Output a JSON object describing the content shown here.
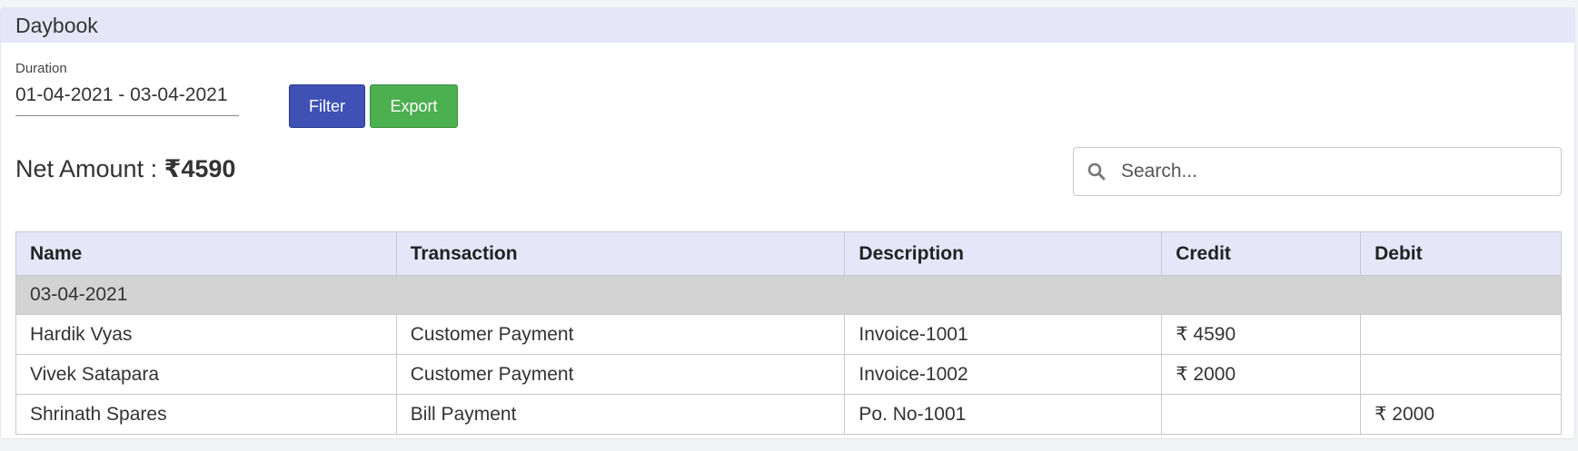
{
  "header": {
    "title": "Daybook"
  },
  "filter": {
    "duration_label": "Duration",
    "duration_value": "01-04-2021 - 03-04-2021",
    "filter_button": "Filter",
    "export_button": "Export"
  },
  "summary": {
    "net_amount_label": "Net Amount : ",
    "net_amount_value": "₹4590"
  },
  "search": {
    "placeholder": "Search...",
    "icon": "search-icon"
  },
  "table": {
    "columns": [
      "Name",
      "Transaction",
      "Description",
      "Credit",
      "Debit"
    ],
    "groups": [
      {
        "date": "03-04-2021",
        "rows": [
          {
            "name": "Hardik Vyas",
            "transaction": "Customer Payment",
            "description": "Invoice-1001",
            "credit": "₹ 4590",
            "debit": ""
          },
          {
            "name": "Vivek Satapara",
            "transaction": "Customer Payment",
            "description": "Invoice-1002",
            "credit": "₹ 2000",
            "debit": ""
          },
          {
            "name": "Shrinath Spares",
            "transaction": "Bill Payment",
            "description": "Po. No-1001",
            "credit": "",
            "debit": "₹ 2000"
          }
        ]
      }
    ]
  },
  "colors": {
    "header_bg": "#e5e7f9",
    "filter_button": "#3f51b5",
    "export_button": "#4caf50",
    "group_row_bg": "#d3d3d3"
  }
}
